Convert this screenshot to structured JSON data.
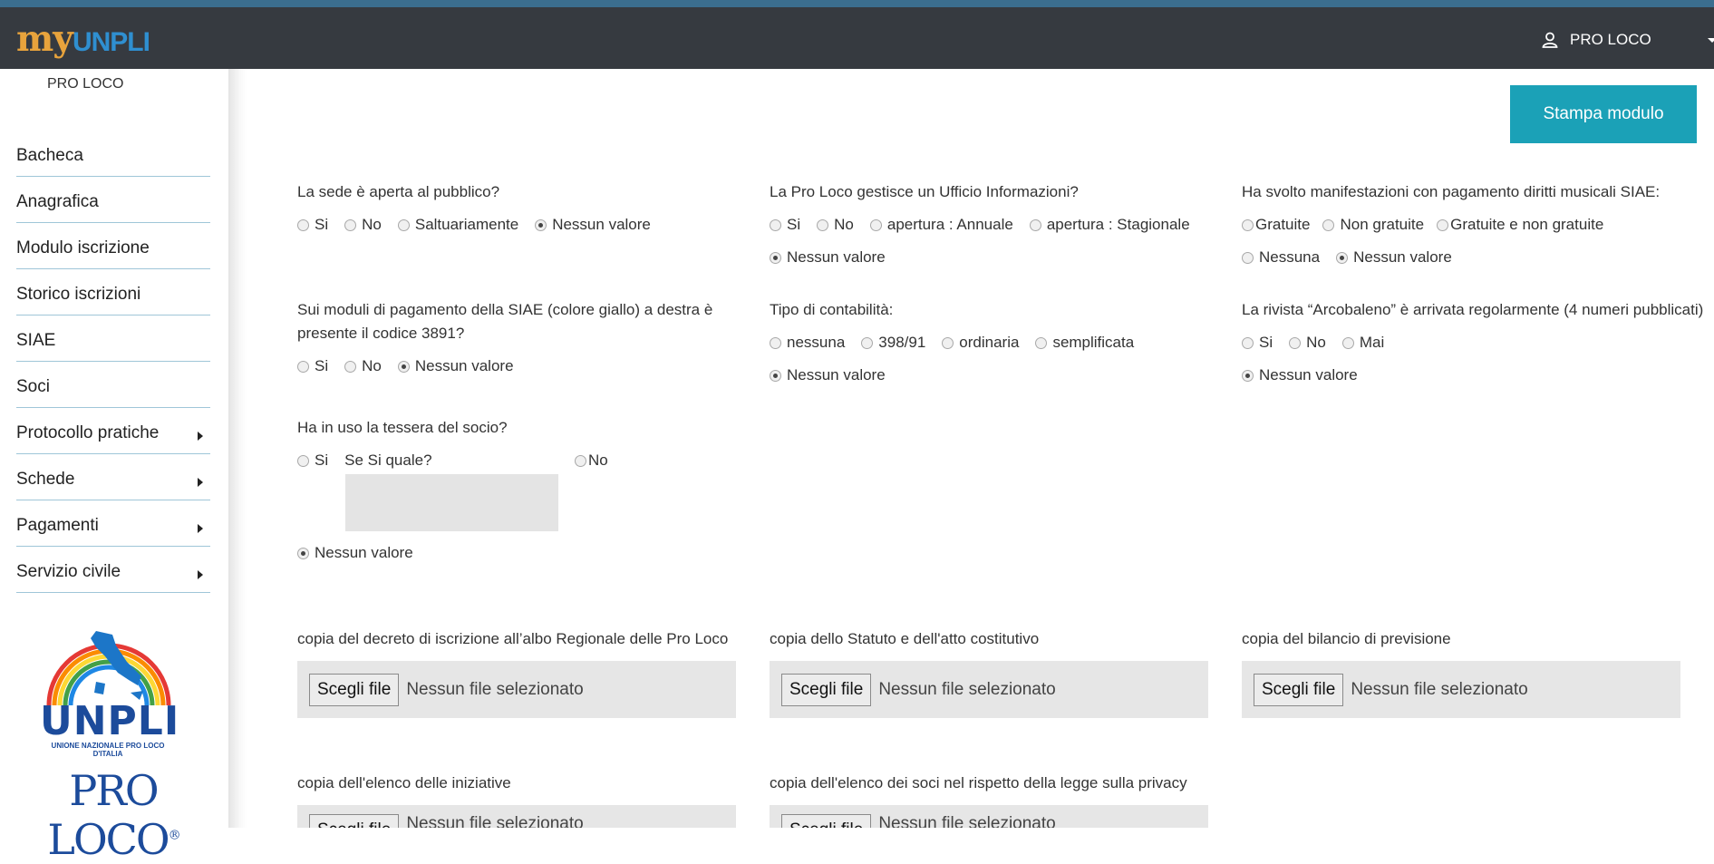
{
  "header": {
    "logo_my": "my",
    "logo_unpli": "UNPLI",
    "user_icon": "user-icon",
    "user_label": "PRO LOCO"
  },
  "sidebar": {
    "org_name": "PRO LOCO",
    "items": [
      {
        "label": "Bacheca",
        "submenu": false
      },
      {
        "label": "Anagrafica",
        "submenu": false
      },
      {
        "label": "Modulo iscrizione",
        "submenu": false
      },
      {
        "label": "Storico iscrizioni",
        "submenu": false
      },
      {
        "label": "SIAE",
        "submenu": false
      },
      {
        "label": "Soci",
        "submenu": false
      },
      {
        "label": "Protocollo pratiche",
        "submenu": true
      },
      {
        "label": "Schede",
        "submenu": true
      },
      {
        "label": "Pagamenti",
        "submenu": true
      },
      {
        "label": "Servizio civile",
        "submenu": true
      }
    ],
    "logo_unpli": "UNPLI",
    "logo_unpli_sub": "UNIONE NAZIONALE PRO LOCO D'ITALIA",
    "logo_proloco": "PRO LOCO"
  },
  "actions": {
    "print_label": "Stampa modulo"
  },
  "questions": {
    "q1": {
      "label": "La sede è aperta al pubblico?",
      "options": [
        "Si",
        "No",
        "Saltuariamente",
        "Nessun valore"
      ],
      "selected": "Nessun valore"
    },
    "q2": {
      "label": "La Pro Loco gestisce un Ufficio Informazioni?",
      "options": [
        "Si",
        "No",
        "apertura : Annuale",
        "apertura : Stagionale",
        "Nessun valore"
      ],
      "selected": "Nessun valore"
    },
    "q3": {
      "label": "Ha svolto manifestazioni con pagamento diritti musicali SIAE:",
      "options": [
        "Gratuite",
        "Non gratuite",
        "Gratuite e non gratuite",
        "Nessuna",
        "Nessun valore"
      ],
      "selected": "Nessun valore"
    },
    "q4": {
      "label_line1": "Sui moduli di pagamento della SIAE (colore giallo) a destra è",
      "label_line2": "presente il codice 3891?",
      "options": [
        "Si",
        "No",
        "Nessun valore"
      ],
      "selected": "Nessun valore"
    },
    "q5": {
      "label": "Tipo di contabilità:",
      "options": [
        "nessuna",
        "398/91",
        "ordinaria",
        "semplificata",
        "Nessun valore"
      ],
      "selected": "Nessun valore"
    },
    "q6": {
      "label": "La rivista “Arcobaleno” è arrivata regolarmente (4 numeri pubblicati)",
      "options": [
        "Si",
        "No",
        "Mai",
        "Nessun valore"
      ],
      "selected": "Nessun valore"
    },
    "q7": {
      "label": "Ha in uso la tessera del socio?",
      "option_si": "Si",
      "se_si_label": "Se Si quale?",
      "se_si_value": "",
      "option_no": "No",
      "option_none": "Nessun valore",
      "selected": "Nessun valore"
    }
  },
  "uploads": {
    "button_label": "Scegli file",
    "no_file_label": "Nessun file selezionato",
    "items": [
      {
        "label": "copia del decreto di iscrizione all’albo Regionale delle Pro Loco"
      },
      {
        "label": "copia dello Statuto e dell'atto costitutivo"
      },
      {
        "label": "copia del bilancio di previsione"
      },
      {
        "label": "copia dell'elenco delle iniziative"
      },
      {
        "label": "copia dell'elenco dei soci nel rispetto della legge sulla privacy"
      }
    ]
  },
  "colors": {
    "topbar": "#363a40",
    "accent": "#1ba1b7",
    "nav_divider": "#9fc6d8",
    "logo_orange": "#e8a33c",
    "logo_blue": "#2f8fd0"
  }
}
